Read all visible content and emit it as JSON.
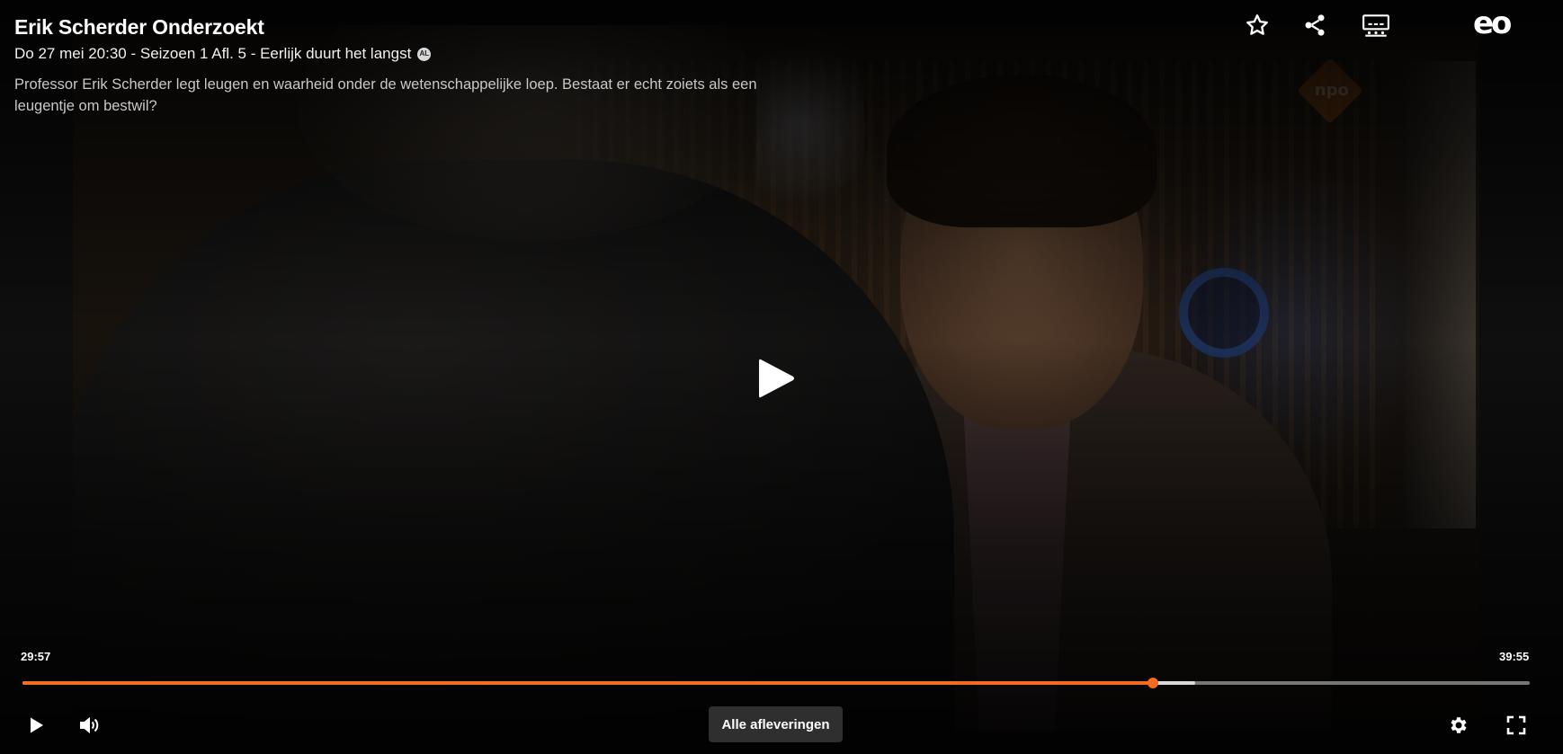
{
  "program": {
    "title": "Erik Scherder Onderzoekt",
    "meta": "Do 27 mei 20:30 - Seizoen 1 Afl. 5 - Eerlijk duurt het langst",
    "age_rating": "AL",
    "description": "Professor Erik Scherder legt leugen en waarheid onder de wetenschappelijke loep. Bestaat er echt zoiets als een leugentje om bestwil?"
  },
  "broadcaster_logo": "eo",
  "channel_watermark": "npo",
  "top_actions": {
    "favorite_icon": "star-icon",
    "share_icon": "share-icon",
    "subtitles_icon": "subtitles-icon"
  },
  "playback": {
    "current_time": "29:57",
    "duration": "39:55",
    "progress_fraction": 0.75,
    "buffered_fraction": 0.778,
    "state": "paused"
  },
  "controls": {
    "episodes_label": "Alle afleveringen",
    "play_icon": "play-icon",
    "volume_icon": "volume-icon",
    "settings_icon": "gear-icon",
    "fullscreen_icon": "fullscreen-icon"
  },
  "colors": {
    "accent": "#f56b1f",
    "buffer": "#d9d9d9",
    "track": "#777777"
  }
}
